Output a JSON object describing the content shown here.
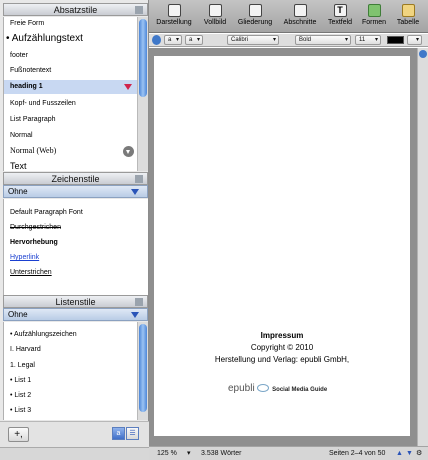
{
  "sidebar": {
    "paragraph_styles": {
      "title": "Absatzstile",
      "items": [
        {
          "label": "Freie Form"
        },
        {
          "label": "Aufzählungstext"
        },
        {
          "label": "footer"
        },
        {
          "label": "Fußnotentext"
        },
        {
          "label": "heading 1"
        },
        {
          "label": "Kopf- und Fusszeilen"
        },
        {
          "label": "List Paragraph"
        },
        {
          "label": "Normal"
        },
        {
          "label": "Normal (Web)"
        },
        {
          "label": "Text"
        }
      ]
    },
    "character_styles": {
      "title": "Zeichenstile",
      "selected": "Ohne",
      "items": [
        {
          "label": "Default Paragraph Font"
        },
        {
          "label": "Durchgestrichen"
        },
        {
          "label": "Hervorhebung"
        },
        {
          "label": "Hyperlink"
        },
        {
          "label": "Unterstrichen"
        }
      ]
    },
    "list_styles": {
      "title": "Listenstile",
      "selected": "Ohne",
      "items": [
        {
          "label": "• Aufzählungszeichen"
        },
        {
          "label": "I. Harvard"
        },
        {
          "label": "1. Legal"
        },
        {
          "label": "• List 1"
        },
        {
          "label": "• List 2"
        },
        {
          "label": "• List 3"
        }
      ]
    },
    "add_button": "+,",
    "view_icon_1": "a"
  },
  "toolbar": {
    "items": [
      {
        "label": "Darstellung",
        "icon": "view-icon"
      },
      {
        "label": "Vollbild",
        "icon": "fullscreen-icon"
      },
      {
        "label": "Gliederung",
        "icon": "outline-icon"
      },
      {
        "label": "Abschnitte",
        "icon": "sections-icon"
      },
      {
        "label": "Textfeld",
        "icon": "textbox-icon"
      },
      {
        "label": "Formen",
        "icon": "shapes-icon"
      },
      {
        "label": "Tabelle",
        "icon": "table-icon"
      }
    ]
  },
  "format_bar": {
    "style_a": "a",
    "style_b": "a",
    "font": "Calibri",
    "weight": "Bold",
    "size": "11"
  },
  "document": {
    "heading": "Impressum",
    "copyright": "Copyright © 2010",
    "publisher": "Herstellung und Verlag: epubli GmbH,",
    "logo_word": "epubli",
    "logo_tagline": "Social Media Guide"
  },
  "status_bar": {
    "zoom": "125 %",
    "word_count": "3.538 Wörter",
    "pages": "Seiten 2–4 von 50"
  },
  "colors": {
    "selection": "#c8d8f2",
    "accent": "#2a54b8",
    "marker": "#d0244c"
  }
}
